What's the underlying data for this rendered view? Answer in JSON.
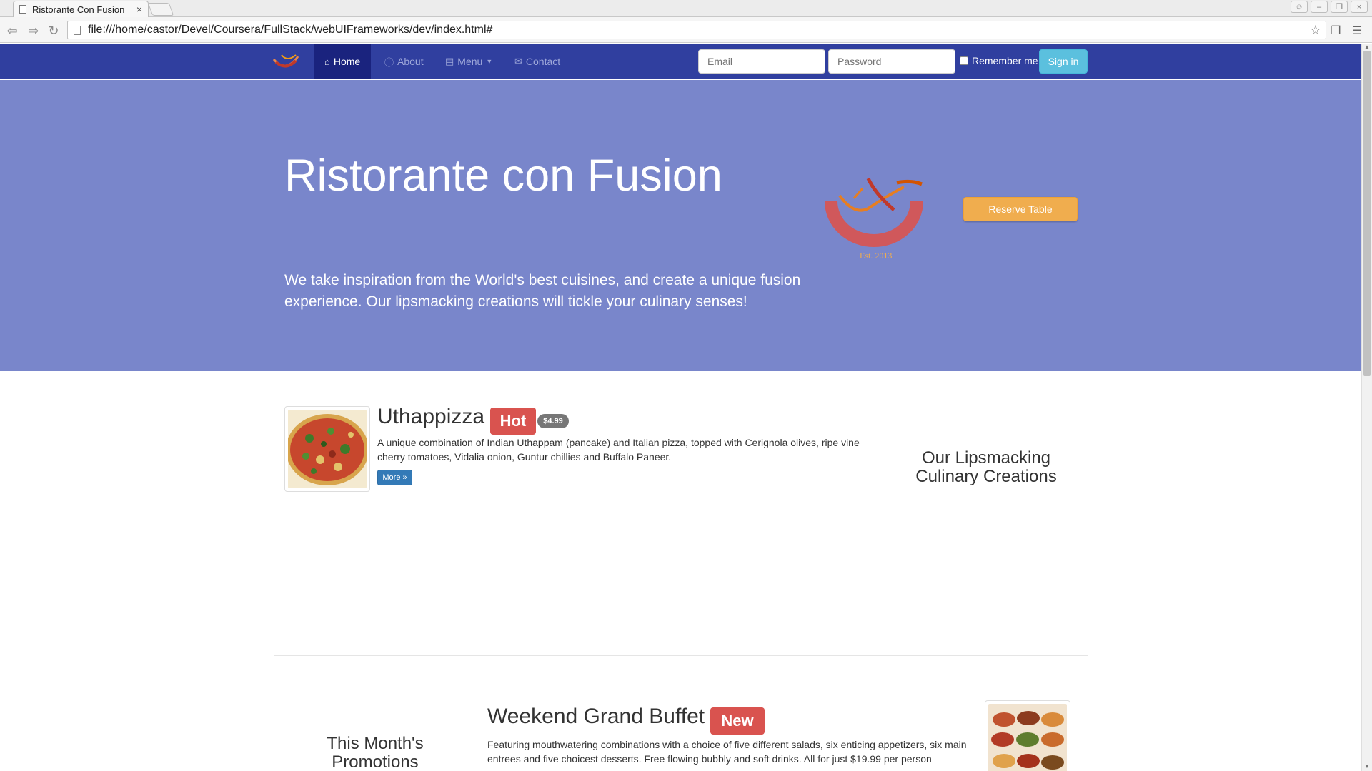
{
  "browser": {
    "tab_title": "Ristorante Con Fusion",
    "tab_close": "×",
    "url": "file:///home/castor/Devel/Coursera/FullStack/webUIFrameworks/dev/index.html#"
  },
  "navbar": {
    "items": [
      {
        "label": "Home",
        "icon": "home-icon"
      },
      {
        "label": "About",
        "icon": "info-icon"
      },
      {
        "label": "Menu",
        "icon": "list-icon"
      },
      {
        "label": "Contact",
        "icon": "envelope-icon"
      }
    ],
    "email_placeholder": "Email",
    "password_placeholder": "Password",
    "remember_label": "Remember me",
    "signin_label": "Sign in",
    "bg_color": "#303f9f",
    "active_color": "#1a237e"
  },
  "jumbotron": {
    "title": "Ristorante con Fusion",
    "text": "We take inspiration from the World's best cuisines, and create a unique fusion experience. Our lipsmacking creations will tickle your culinary senses!",
    "reserve_label": "Reserve Table",
    "bg_color": "#7986cb"
  },
  "featured": {
    "title": "Uthappizza",
    "label": "Hot",
    "price": "$4.99",
    "description": "A unique combination of Indian Uthappam (pancake) and Italian pizza, topped with Cerignola olives, ripe vine cherry tomatoes, Vidalia onion, Guntur chillies and Buffalo Paneer.",
    "more_label": "More »",
    "side_heading": "Our Lipsmacking Culinary Creations"
  },
  "promotion": {
    "side_heading": "This Month's Promotions",
    "title": "Weekend Grand Buffet",
    "label": "New",
    "description": "Featuring mouthwatering combinations with a choice of five different salads, six enticing appetizers, six main entrees and five choicest desserts. Free flowing bubbly and soft drinks. All for just $19.99 per person"
  }
}
